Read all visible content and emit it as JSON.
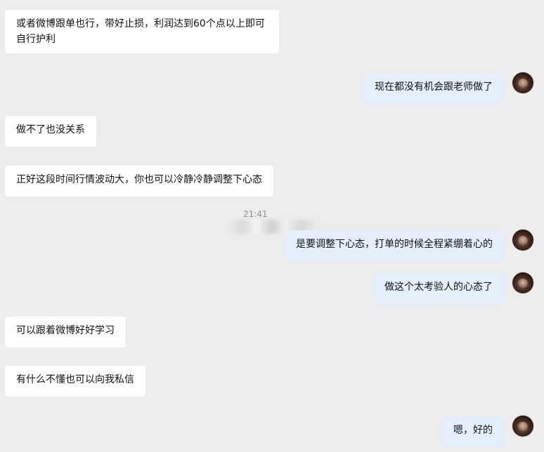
{
  "chat": {
    "timestamp": "21:41",
    "messages": [
      {
        "side": "in",
        "text": "或者微博跟单也行，带好止损，利润达到60个点以上即可自行护利"
      },
      {
        "side": "out",
        "text": "现在都没有机会跟老师做了"
      },
      {
        "side": "in",
        "text": "做不了也没关系"
      },
      {
        "side": "in",
        "text": "正好这段时间行情波动大，你也可以冷静冷静调整下心态"
      },
      {
        "side": "out",
        "text": "是要调整下心态，打单的时候全程紧绷着心的"
      },
      {
        "side": "out",
        "text": "做这个太考验人的心态了"
      },
      {
        "side": "in",
        "text": "可以跟着微博好好学习"
      },
      {
        "side": "in",
        "text": "有什么不懂也可以向我私信"
      },
      {
        "side": "out",
        "text": "嗯，好的"
      }
    ]
  },
  "colors": {
    "background": "#ededed",
    "incoming_bubble": "#ffffff",
    "outgoing_bubble": "#e4effb"
  }
}
